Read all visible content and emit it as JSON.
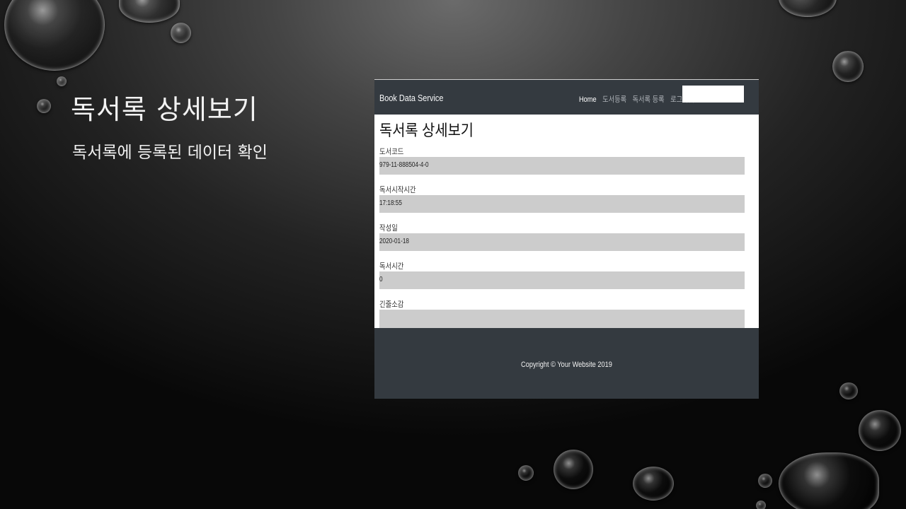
{
  "slide": {
    "title": "독서록 상세보기",
    "subtitle": "독서록에 등록된 데이터 확인"
  },
  "screenshot": {
    "brand": "Book Data Service",
    "nav": [
      {
        "label": "Home",
        "active": true
      },
      {
        "label": "도서등록",
        "active": false
      },
      {
        "label": "독서록 등록",
        "active": false
      },
      {
        "label": "로그아웃",
        "active": false
      }
    ],
    "search_value": "",
    "page_heading": "독서록 상세보기",
    "fields": [
      {
        "label": "도서코드",
        "value": "979-11-888504-4-0"
      },
      {
        "label": "독서시작시간",
        "value": "17:18:55"
      },
      {
        "label": "작성일",
        "value": "2020-01-18"
      },
      {
        "label": "독서시간",
        "value": "0"
      },
      {
        "label": "긴줄소감",
        "value": ""
      }
    ],
    "footer_text": "Copyright © Your Website 2019"
  },
  "colors": {
    "navbar_bg": "#343a40",
    "field_bg": "#cccccc",
    "slide_text": "#f2f2f2"
  }
}
